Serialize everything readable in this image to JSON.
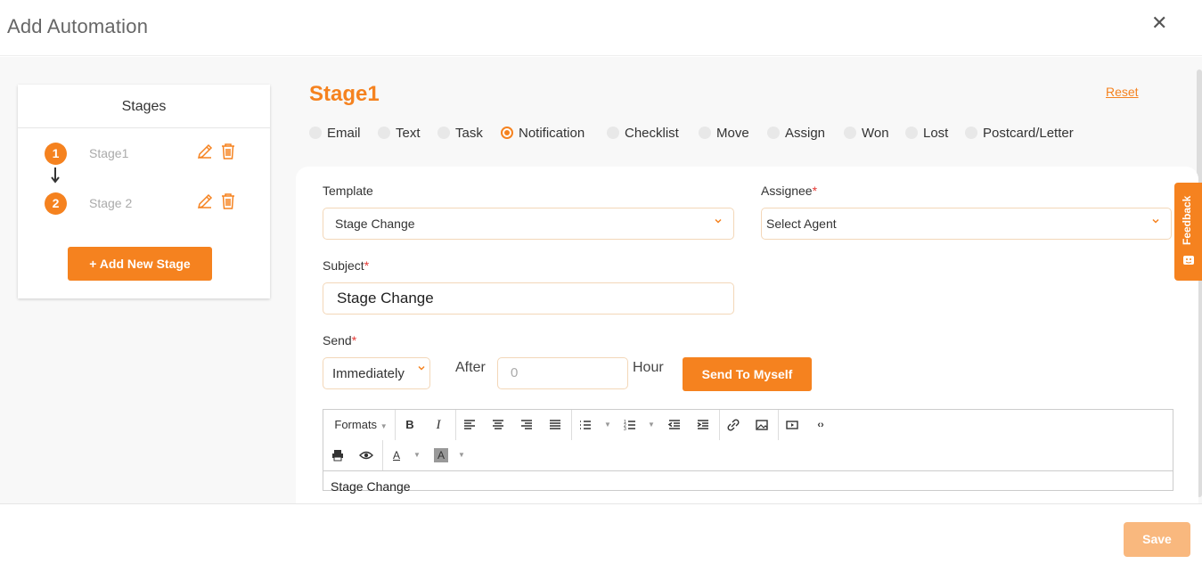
{
  "header": {
    "title": "Add Automation",
    "close_glyph": "✕"
  },
  "stages_panel": {
    "heading": "Stages",
    "stages": [
      {
        "number": "1",
        "name": "Stage1"
      },
      {
        "number": "2",
        "name": "Stage 2"
      }
    ],
    "add_button": "+ Add New Stage"
  },
  "stage_editor": {
    "title": "Stage1",
    "reset_label": "Reset",
    "action_types": [
      {
        "label": "Email",
        "selected": false
      },
      {
        "label": "Text",
        "selected": false
      },
      {
        "label": "Task",
        "selected": false
      },
      {
        "label": "Notification",
        "selected": true
      },
      {
        "label": "Checklist",
        "selected": false
      },
      {
        "label": "Move",
        "selected": false
      },
      {
        "label": "Assign",
        "selected": false
      },
      {
        "label": "Won",
        "selected": false
      },
      {
        "label": "Lost",
        "selected": false
      },
      {
        "label": "Postcard/Letter",
        "selected": false
      }
    ]
  },
  "form": {
    "template_label": "Template",
    "template_value": "Stage Change",
    "assignee_label": "Assignee",
    "assignee_value": "Select Agent",
    "subject_label": "Subject",
    "subject_value": "Stage Change",
    "send_label": "Send",
    "send_value": "Immediately",
    "after_label": "After",
    "after_placeholder": "0",
    "hour_label": "Hour",
    "send_myself_button": "Send To Myself",
    "required_mark": "*"
  },
  "editor": {
    "formats_label": "Formats",
    "body_text": "Stage Change"
  },
  "feedback_tab": {
    "label": "Feedback"
  },
  "footer": {
    "save_label": "Save"
  },
  "colors": {
    "accent": "#f5821f",
    "accent_disabled": "#f9b87e",
    "required": "#e53935"
  }
}
